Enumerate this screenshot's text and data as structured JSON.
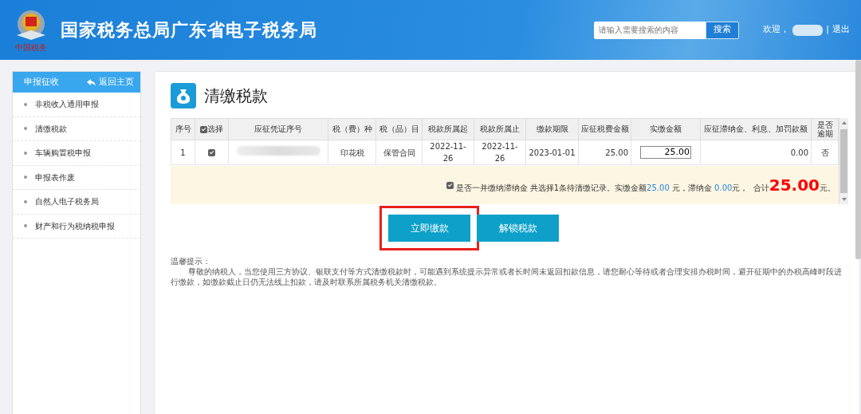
{
  "header": {
    "title": "国家税务总局广东省电子税务局",
    "logo_caption": "中国税务",
    "search": {
      "placeholder": "请输入需要搜索的内容",
      "button": "搜索"
    },
    "welcome": "欢迎，",
    "separator": "|",
    "logout": "退出"
  },
  "sidebar": {
    "title": "申报征收",
    "back": "返回主页",
    "items": [
      {
        "label": "非税收入通用申报",
        "selected": false
      },
      {
        "label": "清缴税款",
        "selected": false
      },
      {
        "label": "车辆购置税申报",
        "selected": false
      },
      {
        "label": "申报表作废",
        "selected": false
      },
      {
        "label": "自然人电子税务局",
        "selected": false
      },
      {
        "label": "财产和行为税纳税申报",
        "selected": false
      }
    ]
  },
  "page_title": "清缴税款",
  "table": {
    "columns": [
      "序号",
      "选择",
      "应征凭证序号",
      "税（费）种",
      "税（品）目",
      "税款所属起",
      "税款所属止",
      "缴款期限",
      "应征税费金额",
      "实缴金额",
      "应征滞纳金、利息、加罚款额",
      "是否逾期"
    ],
    "select_all_checked": true,
    "rows": [
      {
        "index": "1",
        "checked": true,
        "tax_type": "印花税",
        "tax_item": "保管合同",
        "period_start": "2022-11-26",
        "period_end": "2022-11-26",
        "deadline": "2023-01-01",
        "amount_due": "25.00",
        "paid_amount": "25.00",
        "late_fee": "0.00",
        "overdue": "否"
      }
    ]
  },
  "summary": {
    "checkbox_label": "是否一并缴纳滞纳金",
    "checked": true,
    "parts": [
      {
        "kind": "text",
        "text": "共选择1条待清缴记录。实缴金额"
      },
      {
        "kind": "amount",
        "text": "25.00"
      },
      {
        "kind": "text",
        "text": " 元，滞纳金 "
      },
      {
        "kind": "amount",
        "text": "0.00"
      },
      {
        "kind": "text",
        "text": "元，  合计"
      },
      {
        "kind": "total",
        "text": "25.00"
      },
      {
        "kind": "text",
        "text": "元。"
      }
    ]
  },
  "buttons": [
    {
      "label": "立即缴款",
      "highlighted": true
    },
    {
      "label": "解锁税款",
      "highlighted": false
    }
  ],
  "notice": {
    "title": "温馨提示：",
    "body": "尊敬的纳税人，当您使用三方协议、银联支付等方式清缴税款时，可能遇到系统提示异常或者长时间未返回扣款信息，请您耐心等待或者合理安排办税时间，避开征期中的办税高峰时段进行缴款，如缴款截止日仍无法线上扣款，请及时联系所属税务机关清缴税款。"
  }
}
